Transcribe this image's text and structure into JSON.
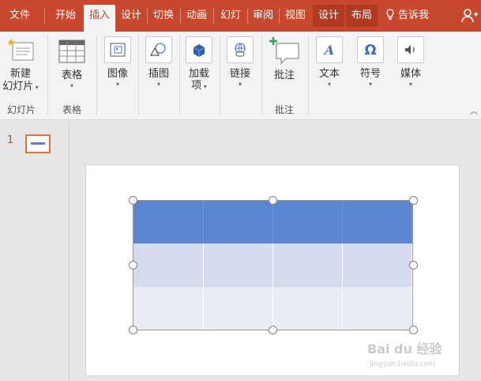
{
  "tabs": [
    {
      "label": "文件"
    },
    {
      "label": "开始"
    },
    {
      "label": "插入"
    },
    {
      "label": "设计"
    },
    {
      "label": "切换"
    },
    {
      "label": "动画"
    },
    {
      "label": "幻灯"
    },
    {
      "label": "审阅"
    },
    {
      "label": "视图"
    },
    {
      "label": "设计"
    },
    {
      "label": "布局"
    }
  ],
  "tell_me": "告诉我",
  "ribbon": {
    "new_slide": {
      "line1": "新建",
      "line2": "幻灯片"
    },
    "table": {
      "label": "表格"
    },
    "image": {
      "label": "图像"
    },
    "illustration": {
      "label": "插图"
    },
    "addin": {
      "line1": "加载",
      "line2": "项"
    },
    "link": {
      "label": "链接"
    },
    "comment": {
      "label": "批注"
    },
    "text": {
      "label": "文本"
    },
    "symbol": {
      "label": "符号"
    },
    "media": {
      "label": "媒体"
    },
    "groups": {
      "slides": "幻灯片",
      "tables": "表格",
      "comments": "批注"
    }
  },
  "slide_panel": {
    "number": "1"
  },
  "watermark": {
    "main": "Bai du 经验",
    "sub": "jingyan.baidu.com"
  },
  "colors": {
    "accent": "#c7482c",
    "table_header": "#5b85d0",
    "table_row1": "#d3dbec",
    "table_row2": "#e9ecf5"
  }
}
